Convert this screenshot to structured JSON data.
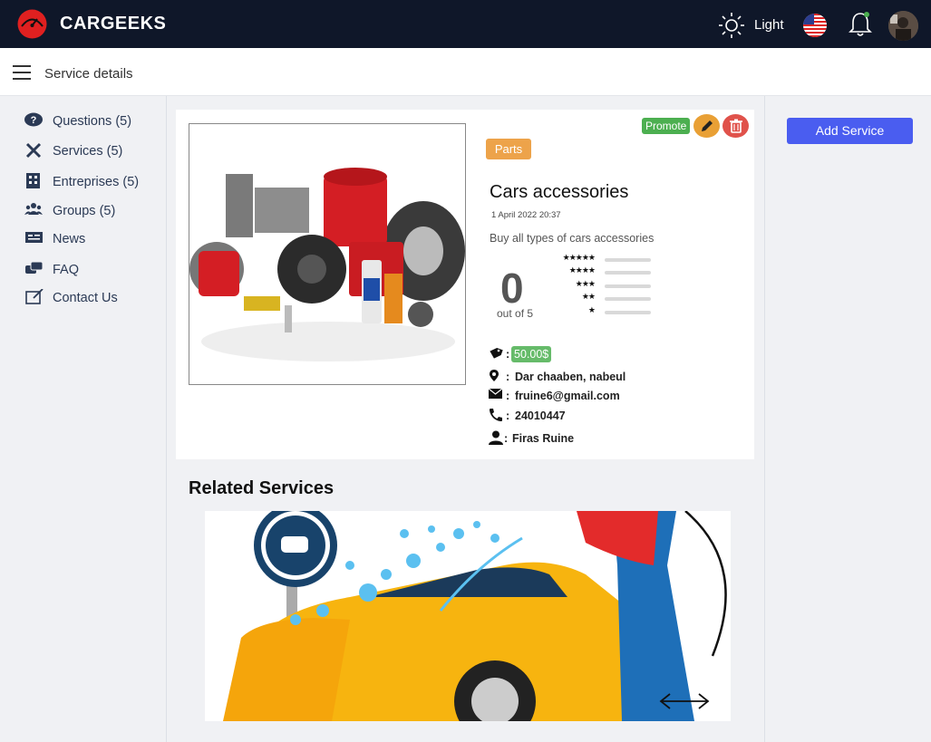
{
  "header": {
    "brand": "CARGEEKS",
    "theme_label": "Light"
  },
  "subheader": {
    "title": "Service details"
  },
  "sidebar": {
    "items": [
      {
        "label": "Questions (5)",
        "icon": "question-icon"
      },
      {
        "label": "Services (5)",
        "icon": "tools-icon"
      },
      {
        "label": "Entreprises (5)",
        "icon": "building-icon"
      },
      {
        "label": "Groups (5)",
        "icon": "users-icon"
      },
      {
        "label": "News",
        "icon": "newspaper-icon"
      },
      {
        "label": "FAQ",
        "icon": "faq-icon"
      },
      {
        "label": "Contact Us",
        "icon": "edit-icon"
      }
    ]
  },
  "service": {
    "actions": {
      "promote_label": "Promote"
    },
    "category": "Parts",
    "title": "Cars accessories",
    "date": "1 April 2022 20:37",
    "description": "Buy all types of cars accessories",
    "rating": {
      "value": "0",
      "out_of": "out of 5",
      "stars": [
        "★★★★★",
        "★★★★",
        "★★★",
        "★★",
        "★"
      ],
      "distribution": [
        0,
        0,
        0,
        0,
        0
      ]
    },
    "price": "50.00$",
    "address": "Dar chaaben, nabeul",
    "email": "fruine6@gmail.com",
    "phone": "24010447",
    "owner": "Firas Ruine",
    "colon": ":"
  },
  "related": {
    "title": "Related Services"
  },
  "right_panel": {
    "add_service_label": "Add Service"
  },
  "colors": {
    "topbar": "#0f1729",
    "promote": "#4caf50",
    "edit": "#e9a035",
    "delete": "#e0524b",
    "tag": "#eda34a",
    "primary_button": "#4a5df0"
  }
}
